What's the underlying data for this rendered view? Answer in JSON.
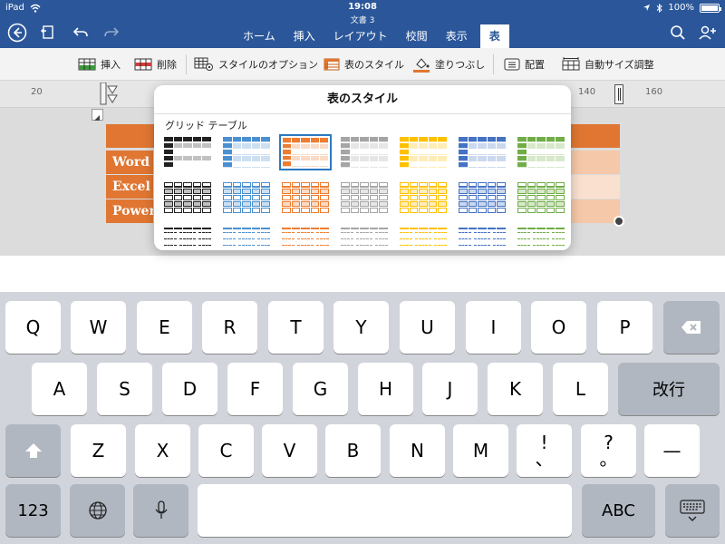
{
  "status": {
    "device": "iPad",
    "time": "19:08",
    "battery": "100%",
    "doc_title": "文書 3"
  },
  "nav": {
    "tabs": [
      "ホーム",
      "挿入",
      "レイアウト",
      "校閲",
      "表示",
      "表"
    ],
    "active_tab": "表"
  },
  "ribbon": {
    "insert": "挿入",
    "delete": "削除",
    "style_options": "スタイルのオプション",
    "table_styles": "表のスタイル",
    "fill": "塗りつぶし",
    "layout": "配置",
    "autofit": "自動サイズ調整"
  },
  "ruler": {
    "labels": [
      "20",
      "140",
      "160"
    ]
  },
  "document": {
    "rows": [
      "",
      "Word",
      "Excel",
      "Power"
    ]
  },
  "popover": {
    "title": "表のスタイル",
    "section": "グリッド テーブル",
    "selected_index": 2
  },
  "colors": {
    "brand": "#2b579a",
    "accent_orange": "#e07632",
    "palette": [
      "#222222",
      "#4a90d0",
      "#ed7d31",
      "#a5a5a5",
      "#ffc000",
      "#4472c4",
      "#70ad47"
    ]
  },
  "keyboard": {
    "row1": [
      "Q",
      "W",
      "E",
      "R",
      "T",
      "Y",
      "U",
      "I",
      "O",
      "P"
    ],
    "row2": [
      "A",
      "S",
      "D",
      "F",
      "G",
      "H",
      "J",
      "K",
      "L"
    ],
    "row3": [
      "Z",
      "X",
      "C",
      "V",
      "B",
      "N",
      "M"
    ],
    "return": "改行",
    "punct1_top": "!",
    "punct1_bottom": "、",
    "punct2_top": "?",
    "punct2_bottom": "。",
    "dash": "—",
    "numbers": "123",
    "abc": "ABC"
  }
}
